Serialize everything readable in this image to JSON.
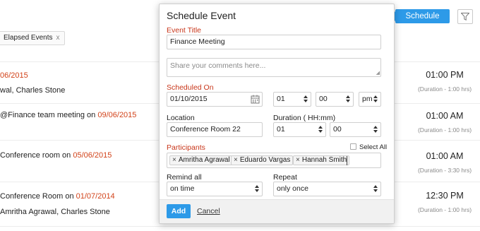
{
  "toolbar": {
    "schedule_event_label": "Schedule Event"
  },
  "filters": {
    "elapsed_chip": "Elapsed Events",
    "chip_remove": "x"
  },
  "events": [
    {
      "date_fragment": "06/2015",
      "line2": "wal, Charles Stone",
      "time": "01:00 PM",
      "duration": "(Duration - 1:00 hrs)"
    },
    {
      "prefix": "@Finance team meeting  on ",
      "date": "09/06/2015",
      "time": "01:00 AM",
      "duration": "(Duration - 1:00 hrs)"
    },
    {
      "prefix": "Conference room  on ",
      "date": "05/06/2015",
      "time": "01:00 AM",
      "duration": "(Duration - 3:30 hrs)"
    },
    {
      "prefix": "Conference Room  on ",
      "date": "01/07/2014",
      "line2": "Amritha Agrawal, Charles Stone",
      "time": "12:30 PM",
      "duration": "(Duration - 1:00 hrs)"
    }
  ],
  "modal": {
    "title": "Schedule Event",
    "event_title_label": "Event Title",
    "event_title_value": "Finance Meeting",
    "comments_placeholder": "Share your comments here...",
    "scheduled_on_label": "Scheduled On",
    "date_value": "01/10/2015",
    "hour_value": "01",
    "minute_value": "00",
    "ampm_value": "pm",
    "location_label": "Location",
    "location_value": "Conference Room 22",
    "duration_label": "Duration ( HH:mm)",
    "duration_hours": "01",
    "duration_minutes": "00",
    "participants_label": "Participants",
    "select_all_label": "Select All",
    "participants": [
      "Amritha Agrawal",
      "Eduardo Vargas",
      "Hannah Smith"
    ],
    "tag_remove": "×",
    "remind_label": "Remind all",
    "remind_value": "on time",
    "repeat_label": "Repeat",
    "repeat_value": "only once",
    "add_label": "Add",
    "cancel_label": "Cancel"
  },
  "colors": {
    "accent": "#2d9ae8",
    "required": "#c8361a",
    "date_red": "#d2431a"
  }
}
